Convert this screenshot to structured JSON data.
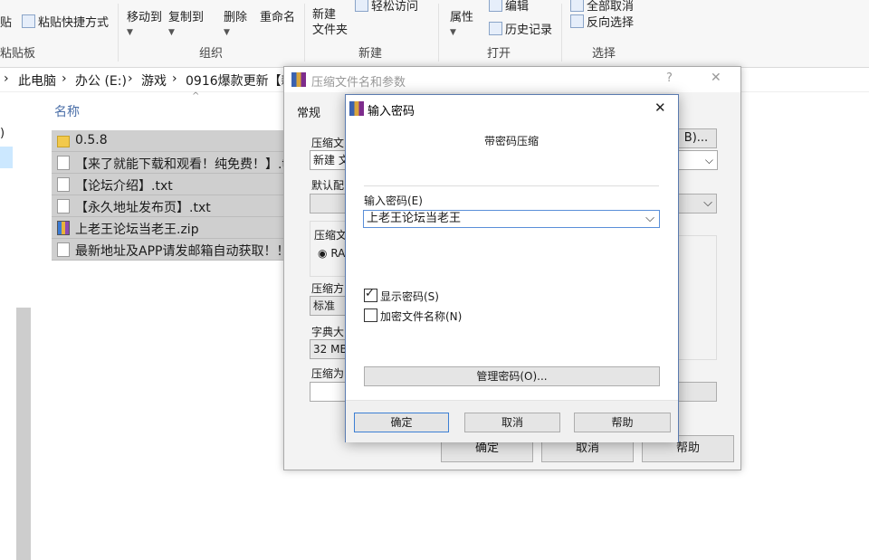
{
  "ribbon": {
    "paste_shortcut": "粘贴快捷方式",
    "move_to": "移动到",
    "copy_to": "复制到",
    "delete": "删除",
    "rename": "重命名",
    "new_folder": "新建\n文件夹",
    "properties": "属性",
    "edit": "编辑",
    "history": "历史记录",
    "select_none": "全部取消",
    "invert_selection": "反向选择",
    "easy_access": "轻松访问",
    "groups": {
      "clipboard": "粘贴板",
      "organize": "组织",
      "new": "新建",
      "open": "打开",
      "select": "选择"
    },
    "partial_top_left": "贴"
  },
  "address": {
    "this_pc": "此电脑",
    "drive": "办公 (E:)",
    "folder1": "游戏",
    "folder2": "0916爆款更新【新"
  },
  "explorer": {
    "column_name": "名称",
    "files": [
      {
        "name": "0.5.8",
        "type": "folder"
      },
      {
        "name": "【来了就能下载和观看！纯免费！】.txt",
        "type": "txt"
      },
      {
        "name": "【论坛介绍】.txt",
        "type": "txt"
      },
      {
        "name": "【永久地址发布页】.txt",
        "type": "txt"
      },
      {
        "name": "上老王论坛当老王.zip",
        "type": "zip"
      },
      {
        "name": "最新地址及APP请发邮箱自动获取！！！",
        "type": "txt"
      }
    ]
  },
  "archive_dialog": {
    "title": "压缩文件名和参数",
    "help": "?",
    "close": "✕",
    "tab_general": "常规",
    "label_archive_name": "压缩文",
    "archive_name_value": "新建 文",
    "browse": "B)...",
    "label_default": "默认配",
    "label_format": "压缩文",
    "format_value": "RA",
    "label_method": "压缩方",
    "method_value": "标准",
    "label_dict": "字典大",
    "dict_value": "32 MB",
    "label_split": "压缩为",
    "ok": "确定",
    "cancel": "取消",
    "help_btn": "帮助"
  },
  "password_dialog": {
    "title": "输入密码",
    "close": "✕",
    "heading": "带密码压缩",
    "label_password": "输入密码(E)",
    "password_value": "上老王论坛当老王",
    "show_password": "显示密码(S)",
    "show_password_checked": true,
    "encrypt_names": "加密文件名称(N)",
    "encrypt_names_checked": false,
    "manage": "管理密码(O)...",
    "ok": "确定",
    "cancel": "取消",
    "help": "帮助"
  }
}
